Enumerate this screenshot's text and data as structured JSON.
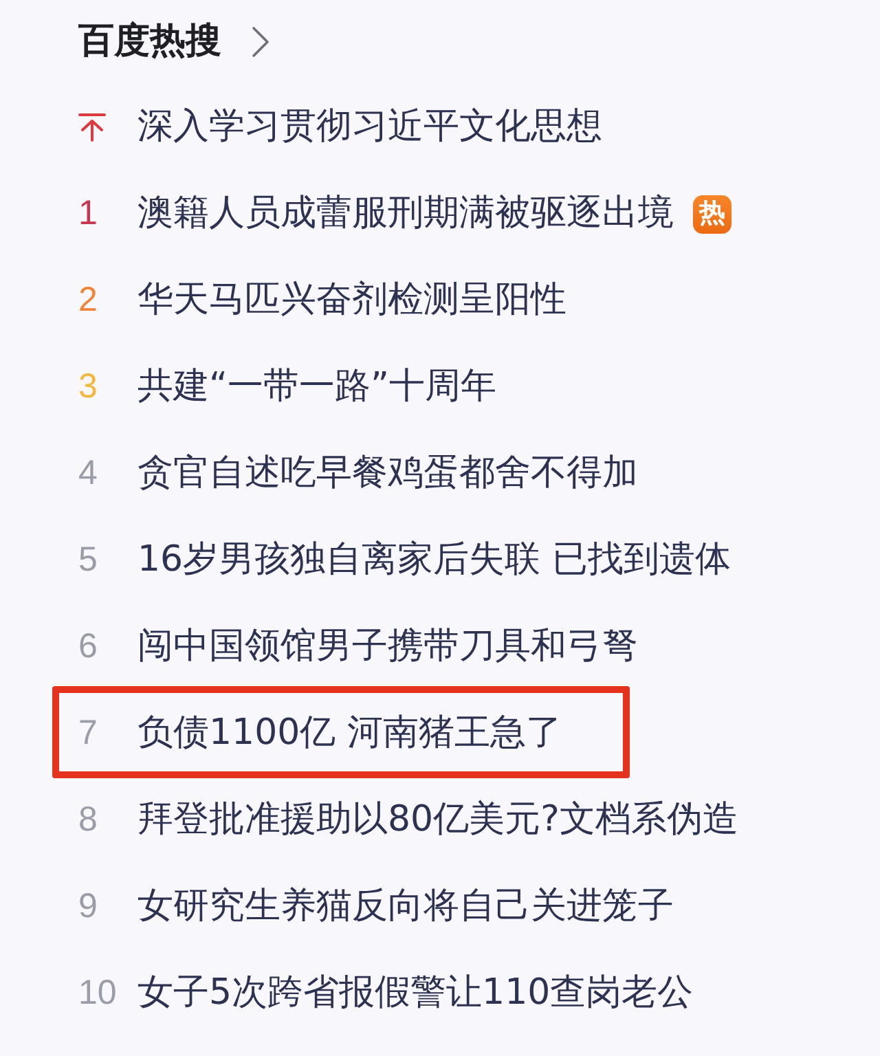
{
  "header": {
    "title": "百度热搜"
  },
  "items": [
    {
      "kind": "pinned",
      "color": "#dc3a3f",
      "title": "深入学习贯彻习近平文化思想",
      "highlighted": false
    },
    {
      "kind": "ranked",
      "rank": "1",
      "color": "#c8364e",
      "title": "澳籍人员成蕾服刑期满被驱逐出境",
      "badge": "热",
      "highlighted": false
    },
    {
      "kind": "ranked",
      "rank": "2",
      "color": "#ee853a",
      "title": "华天马匹兴奋剂检测呈阳性",
      "highlighted": false
    },
    {
      "kind": "ranked",
      "rank": "3",
      "color": "#f2b73e",
      "title": "共建“一带一路”十周年",
      "highlighted": false
    },
    {
      "kind": "ranked",
      "rank": "4",
      "color": "#9a9ca8",
      "title": "贪官自述吃早餐鸡蛋都舍不得加",
      "highlighted": false
    },
    {
      "kind": "ranked",
      "rank": "5",
      "color": "#9a9ca8",
      "title": "16岁男孩独自离家后失联 已找到遗体",
      "highlighted": false
    },
    {
      "kind": "ranked",
      "rank": "6",
      "color": "#9a9ca8",
      "title": "闯中国领馆男子携带刀具和弓弩",
      "highlighted": false
    },
    {
      "kind": "ranked",
      "rank": "7",
      "color": "#9a9ca8",
      "title": "负债1100亿 河南猪王急了",
      "highlighted": true
    },
    {
      "kind": "ranked",
      "rank": "8",
      "color": "#9a9ca8",
      "title": "拜登批准援助以80亿美元?文档系伪造",
      "highlighted": false
    },
    {
      "kind": "ranked",
      "rank": "9",
      "color": "#9a9ca8",
      "title": "女研究生养猫反向将自己关进笼子",
      "highlighted": false
    },
    {
      "kind": "ranked",
      "rank": "10",
      "color": "#9a9ca8",
      "title": "女子5次跨省报假警让110查岗老公",
      "highlighted": false
    }
  ]
}
